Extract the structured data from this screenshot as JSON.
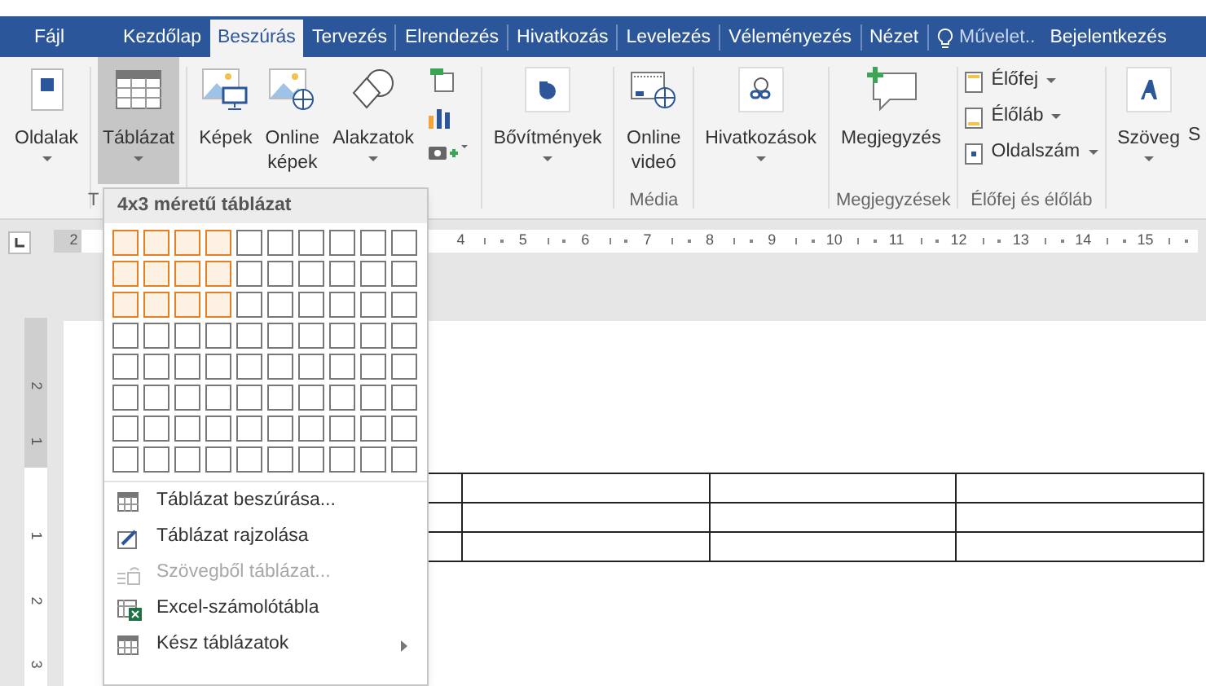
{
  "tabs": [
    {
      "label": "Fájl",
      "selected": false
    },
    {
      "label": "Kezdőlap",
      "selected": false
    },
    {
      "label": "Beszúrás",
      "selected": true
    },
    {
      "label": "Tervezés",
      "selected": false
    },
    {
      "label": "Elrendezés",
      "selected": false
    },
    {
      "label": "Hivatkozás",
      "selected": false
    },
    {
      "label": "Levelezés",
      "selected": false
    },
    {
      "label": "Véleményezés",
      "selected": false
    },
    {
      "label": "Nézet",
      "selected": false
    }
  ],
  "tell_me": {
    "label": "Művelet.."
  },
  "account": {
    "label": "Bejelentkezés"
  },
  "ribbon_groups": [
    {
      "items": [
        {
          "kind": "large",
          "label": "Oldalak",
          "dropdown": true,
          "pressed": false
        }
      ]
    },
    {
      "label": "T",
      "items": [
        {
          "kind": "large",
          "label": "Táblázat",
          "dropdown": true,
          "pressed": true
        }
      ]
    },
    {
      "items": [
        {
          "kind": "large",
          "label": "Képek",
          "dropdown": false,
          "pressed": false
        },
        {
          "kind": "large",
          "label": "Online képek",
          "dropdown": false,
          "pressed": false
        },
        {
          "kind": "large",
          "label": "Alakzatok",
          "dropdown": true,
          "pressed": false
        },
        {
          "kind": "icons"
        }
      ]
    },
    {
      "items": [
        {
          "kind": "large",
          "label": "Bővítmények",
          "dropdown": true,
          "pressed": false
        }
      ]
    },
    {
      "label": "Média",
      "items": [
        {
          "kind": "large",
          "label": "Online videó",
          "dropdown": false,
          "pressed": false
        }
      ]
    },
    {
      "items": [
        {
          "kind": "large",
          "label": "Hivatkozások",
          "dropdown": true,
          "pressed": false
        }
      ]
    },
    {
      "label": "Megjegyzések",
      "items": [
        {
          "kind": "large",
          "label": "Megjegyzés",
          "dropdown": false,
          "pressed": false
        }
      ]
    },
    {
      "label": "Élőfej és élőláb",
      "items": [
        {
          "kind": "small",
          "label": "Élőfej",
          "dropdown": true
        },
        {
          "kind": "small",
          "label": "Élőláb",
          "dropdown": true
        },
        {
          "kind": "small",
          "label": "Oldalszám",
          "dropdown": true
        }
      ]
    },
    {
      "items": [
        {
          "kind": "large",
          "label": "Szöveg",
          "dropdown": true,
          "pressed": false
        },
        {
          "kind": "cut",
          "label": "S"
        }
      ]
    }
  ],
  "ruler": {
    "left_number": "2",
    "numbers": [
      "4",
      "5",
      "6",
      "7",
      "8",
      "9",
      "10",
      "11",
      "12",
      "13",
      "14",
      "15"
    ]
  },
  "vertical_ruler": {
    "numbers": [
      "2",
      "1",
      "1",
      "2",
      "3"
    ]
  },
  "table_menu": {
    "title": "4x3 méretű táblázat",
    "grid": [
      {
        "cells": [
          {
            "selected": true
          },
          {
            "selected": true
          },
          {
            "selected": true
          },
          {
            "selected": true
          },
          {
            "selected": false
          },
          {
            "selected": false
          },
          {
            "selected": false
          },
          {
            "selected": false
          },
          {
            "selected": false
          },
          {
            "selected": false
          }
        ]
      },
      {
        "cells": [
          {
            "selected": true
          },
          {
            "selected": true
          },
          {
            "selected": true
          },
          {
            "selected": true
          },
          {
            "selected": false
          },
          {
            "selected": false
          },
          {
            "selected": false
          },
          {
            "selected": false
          },
          {
            "selected": false
          },
          {
            "selected": false
          }
        ]
      },
      {
        "cells": [
          {
            "selected": true
          },
          {
            "selected": true
          },
          {
            "selected": true
          },
          {
            "selected": true
          },
          {
            "selected": false
          },
          {
            "selected": false
          },
          {
            "selected": false
          },
          {
            "selected": false
          },
          {
            "selected": false
          },
          {
            "selected": false
          }
        ]
      },
      {
        "cells": [
          {
            "selected": false
          },
          {
            "selected": false
          },
          {
            "selected": false
          },
          {
            "selected": false
          },
          {
            "selected": false
          },
          {
            "selected": false
          },
          {
            "selected": false
          },
          {
            "selected": false
          },
          {
            "selected": false
          },
          {
            "selected": false
          }
        ]
      },
      {
        "cells": [
          {
            "selected": false
          },
          {
            "selected": false
          },
          {
            "selected": false
          },
          {
            "selected": false
          },
          {
            "selected": false
          },
          {
            "selected": false
          },
          {
            "selected": false
          },
          {
            "selected": false
          },
          {
            "selected": false
          },
          {
            "selected": false
          }
        ]
      },
      {
        "cells": [
          {
            "selected": false
          },
          {
            "selected": false
          },
          {
            "selected": false
          },
          {
            "selected": false
          },
          {
            "selected": false
          },
          {
            "selected": false
          },
          {
            "selected": false
          },
          {
            "selected": false
          },
          {
            "selected": false
          },
          {
            "selected": false
          }
        ]
      },
      {
        "cells": [
          {
            "selected": false
          },
          {
            "selected": false
          },
          {
            "selected": false
          },
          {
            "selected": false
          },
          {
            "selected": false
          },
          {
            "selected": false
          },
          {
            "selected": false
          },
          {
            "selected": false
          },
          {
            "selected": false
          },
          {
            "selected": false
          }
        ]
      },
      {
        "cells": [
          {
            "selected": false
          },
          {
            "selected": false
          },
          {
            "selected": false
          },
          {
            "selected": false
          },
          {
            "selected": false
          },
          {
            "selected": false
          },
          {
            "selected": false
          },
          {
            "selected": false
          },
          {
            "selected": false
          },
          {
            "selected": false
          }
        ]
      }
    ],
    "items": [
      {
        "label": "Táblázat beszúrása...",
        "disabled": false,
        "submenu": false
      },
      {
        "label": "Táblázat rajzolása",
        "disabled": false,
        "submenu": false
      },
      {
        "label": "Szövegből táblázat...",
        "disabled": true,
        "submenu": false
      },
      {
        "label": "Excel-számolótábla",
        "disabled": false,
        "submenu": false
      },
      {
        "label": "Kész táblázatok",
        "disabled": false,
        "submenu": true
      }
    ]
  }
}
